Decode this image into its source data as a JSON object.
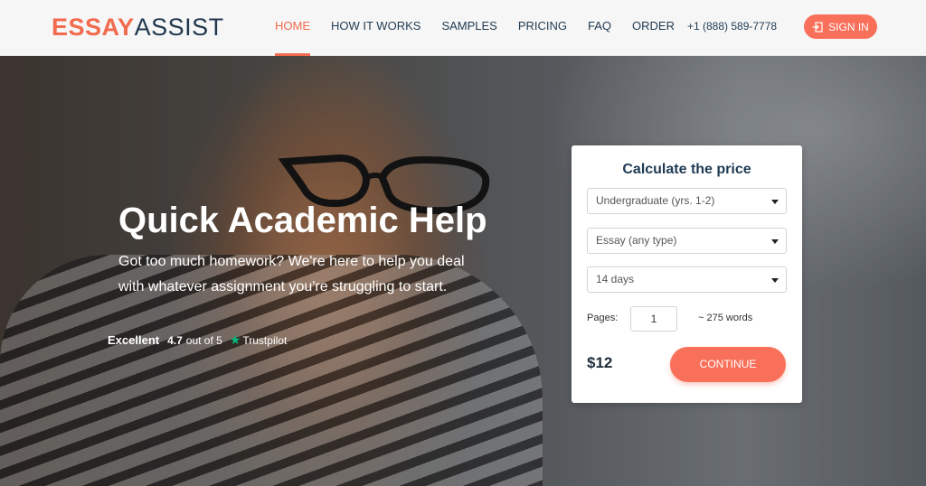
{
  "header": {
    "logo_part1": "ESSAY",
    "logo_part2": "ASSIST",
    "nav": [
      {
        "label": "HOME",
        "active": true
      },
      {
        "label": "HOW IT WORKS",
        "active": false
      },
      {
        "label": "SAMPLES",
        "active": false
      },
      {
        "label": "PRICING",
        "active": false
      },
      {
        "label": "FAQ",
        "active": false
      },
      {
        "label": "ORDER",
        "active": false
      }
    ],
    "phone": "+1 (888) 589-7778",
    "signin_label": "SIGN IN",
    "signin_icon": "sign-in-icon"
  },
  "hero": {
    "title": "Quick Academic Help",
    "subtitle": "Got too much homework? We're here to help you deal with whatever assignment you're struggling to start.",
    "rating": {
      "label": "Excellent",
      "score": "4.7",
      "out_of": "out of 5",
      "provider": "Trustpilot",
      "star_icon": "trustpilot-star-icon"
    }
  },
  "calculator": {
    "title": "Calculate the price",
    "academic_level": "Undergraduate (yrs. 1-2)",
    "paper_type": "Essay (any type)",
    "deadline": "14 days",
    "pages_label": "Pages:",
    "pages_value": "1",
    "words": "~ 275 words",
    "price": "$12",
    "continue_label": "CONTINUE"
  },
  "colors": {
    "accent": "#f26b4e",
    "button": "#f9705a",
    "navy": "#1f3a52",
    "trustpilot_green": "#00b67a"
  }
}
